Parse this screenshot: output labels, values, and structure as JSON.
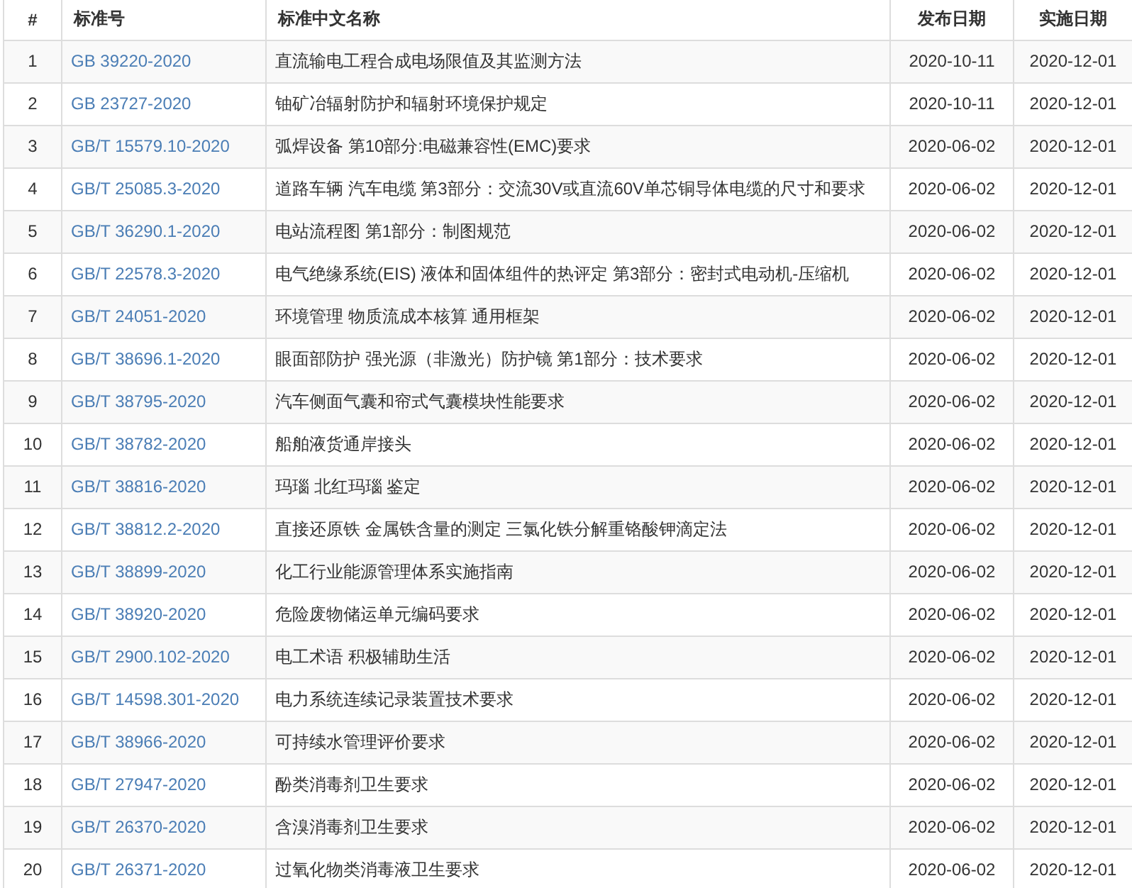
{
  "table": {
    "columns": [
      "#",
      "标准号",
      "标准中文名称",
      "发布日期",
      "实施日期"
    ],
    "rows": [
      {
        "index": "1",
        "code": "GB 39220-2020",
        "name": "直流输电工程合成电场限值及其监测方法",
        "published": "2020-10-11",
        "effective": "2020-12-01"
      },
      {
        "index": "2",
        "code": "GB 23727-2020",
        "name": "铀矿冶辐射防护和辐射环境保护规定",
        "published": "2020-10-11",
        "effective": "2020-12-01"
      },
      {
        "index": "3",
        "code": "GB/T 15579.10-2020",
        "name": "弧焊设备 第10部分:电磁兼容性(EMC)要求",
        "published": "2020-06-02",
        "effective": "2020-12-01"
      },
      {
        "index": "4",
        "code": "GB/T 25085.3-2020",
        "name": "道路车辆 汽车电缆 第3部分：交流30V或直流60V单芯铜导体电缆的尺寸和要求",
        "published": "2020-06-02",
        "effective": "2020-12-01"
      },
      {
        "index": "5",
        "code": "GB/T 36290.1-2020",
        "name": "电站流程图 第1部分：制图规范",
        "published": "2020-06-02",
        "effective": "2020-12-01"
      },
      {
        "index": "6",
        "code": "GB/T 22578.3-2020",
        "name": "电气绝缘系统(EIS) 液体和固体组件的热评定 第3部分：密封式电动机-压缩机",
        "published": "2020-06-02",
        "effective": "2020-12-01"
      },
      {
        "index": "7",
        "code": "GB/T 24051-2020",
        "name": "环境管理 物质流成本核算 通用框架",
        "published": "2020-06-02",
        "effective": "2020-12-01"
      },
      {
        "index": "8",
        "code": "GB/T 38696.1-2020",
        "name": "眼面部防护 强光源（非激光）防护镜 第1部分：技术要求",
        "published": "2020-06-02",
        "effective": "2020-12-01"
      },
      {
        "index": "9",
        "code": "GB/T 38795-2020",
        "name": "汽车侧面气囊和帘式气囊模块性能要求",
        "published": "2020-06-02",
        "effective": "2020-12-01"
      },
      {
        "index": "10",
        "code": "GB/T 38782-2020",
        "name": "船舶液货通岸接头",
        "published": "2020-06-02",
        "effective": "2020-12-01"
      },
      {
        "index": "11",
        "code": "GB/T 38816-2020",
        "name": "玛瑙 北红玛瑙 鉴定",
        "published": "2020-06-02",
        "effective": "2020-12-01"
      },
      {
        "index": "12",
        "code": "GB/T 38812.2-2020",
        "name": "直接还原铁 金属铁含量的测定 三氯化铁分解重铬酸钾滴定法",
        "published": "2020-06-02",
        "effective": "2020-12-01"
      },
      {
        "index": "13",
        "code": "GB/T 38899-2020",
        "name": "化工行业能源管理体系实施指南",
        "published": "2020-06-02",
        "effective": "2020-12-01"
      },
      {
        "index": "14",
        "code": "GB/T 38920-2020",
        "name": "危险废物储运单元编码要求",
        "published": "2020-06-02",
        "effective": "2020-12-01"
      },
      {
        "index": "15",
        "code": "GB/T 2900.102-2020",
        "name": "电工术语 积极辅助生活",
        "published": "2020-06-02",
        "effective": "2020-12-01"
      },
      {
        "index": "16",
        "code": "GB/T 14598.301-2020",
        "name": "电力系统连续记录装置技术要求",
        "published": "2020-06-02",
        "effective": "2020-12-01"
      },
      {
        "index": "17",
        "code": "GB/T 38966-2020",
        "name": "可持续水管理评价要求",
        "published": "2020-06-02",
        "effective": "2020-12-01"
      },
      {
        "index": "18",
        "code": "GB/T 27947-2020",
        "name": "酚类消毒剂卫生要求",
        "published": "2020-06-02",
        "effective": "2020-12-01"
      },
      {
        "index": "19",
        "code": "GB/T 26370-2020",
        "name": "含溴消毒剂卫生要求",
        "published": "2020-06-02",
        "effective": "2020-12-01"
      },
      {
        "index": "20",
        "code": "GB/T 26371-2020",
        "name": "过氧化物类消毒液卫生要求",
        "published": "2020-06-02",
        "effective": "2020-12-01"
      }
    ]
  }
}
